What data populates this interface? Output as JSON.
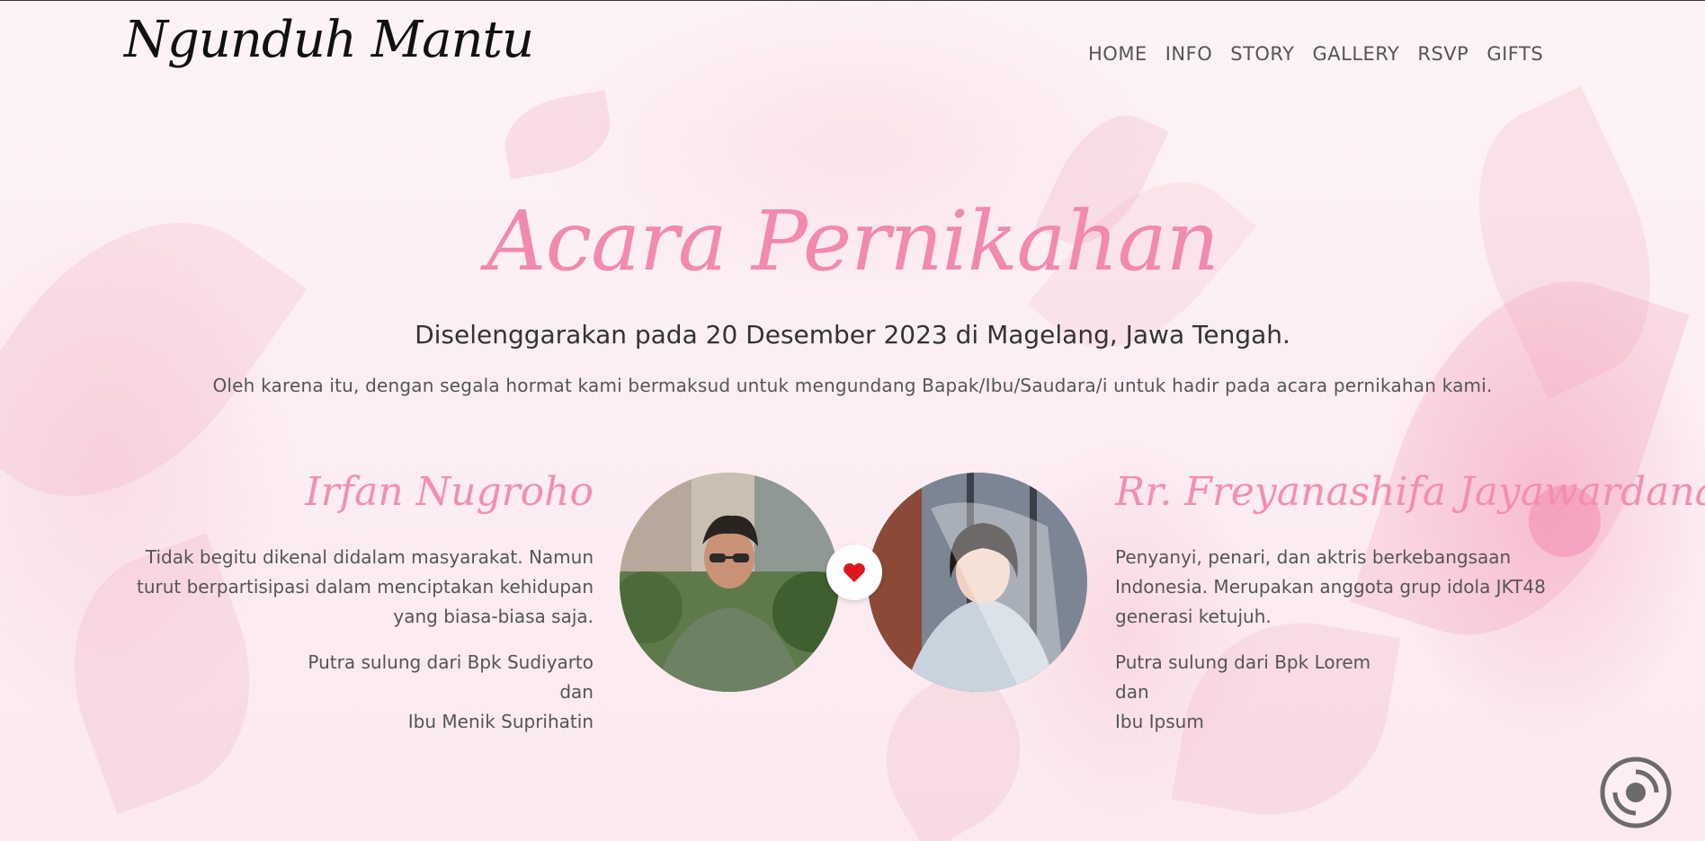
{
  "header": {
    "logo": "Ngunduh Mantu",
    "nav": [
      "HOME",
      "INFO",
      "STORY",
      "GALLERY",
      "RSVP",
      "GIFTS"
    ]
  },
  "hero": {
    "title": "Acara Pernikahan",
    "subtitle": "Diselenggarakan pada 20 Desember 2023 di Magelang, Jawa Tengah.",
    "intro": "Oleh karena itu, dengan segala hormat kami bermaksud untuk mengundang Bapak/Ibu/Saudara/i untuk hadir pada acara pernikahan kami."
  },
  "groom": {
    "name": "Irfan Nugroho",
    "bio": "Tidak begitu dikenal didalam masyarakat. Namun turut berpartisipasi dalam menciptakan kehidupan yang biasa-biasa saja.",
    "parent_line1": "Putra sulung dari Bpk Sudiyarto",
    "parent_line2": "dan",
    "parent_line3": "Ibu Menik Suprihatin"
  },
  "bride": {
    "name": "Rr. Freyanashifa Jayawardana",
    "bio": "Penyanyi, penari, dan aktris berkebangsaan Indonesia. Merupakan anggota grup idola JKT48 generasi ketujuh.",
    "parent_line1": "Putra sulung dari Bpk Lorem",
    "parent_line2": "dan",
    "parent_line3": "Ibu Ipsum"
  },
  "icons": {
    "heart": "heart-icon",
    "music": "music-disc-icon"
  },
  "colors": {
    "accent_pink": "#f28aab",
    "heart_red": "#e0161e",
    "text_dark": "#333333",
    "text_muted": "#555555"
  }
}
